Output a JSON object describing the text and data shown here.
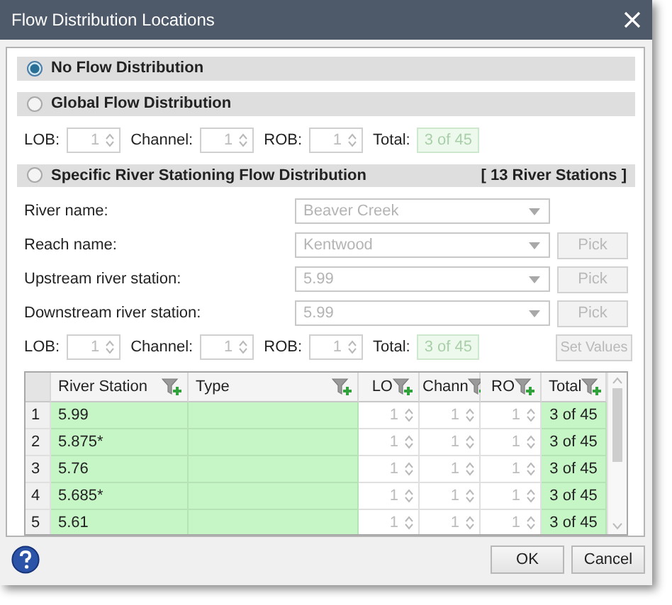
{
  "window": {
    "title": "Flow Distribution Locations"
  },
  "sections": [
    {
      "label": "No Flow Distribution",
      "selected": true
    },
    {
      "label": "Global Flow Distribution",
      "selected": false,
      "distribution": {
        "lob": {
          "label": "LOB:",
          "value": "1",
          "disabled": true
        },
        "channel": {
          "label": "Channel:",
          "value": "1",
          "disabled": true
        },
        "rob": {
          "label": "ROB:",
          "value": "1",
          "disabled": true
        },
        "total": {
          "label": "Total:",
          "value": "3 of 45"
        }
      }
    },
    {
      "label": "Specific River Stationing Flow Distribution",
      "selected": false,
      "badge": "[ 13 River Stations ]",
      "fields": [
        {
          "label": "River name:",
          "value": "Beaver Creek",
          "disabled": true
        },
        {
          "label": "Reach name:",
          "value": "Kentwood",
          "disabled": true,
          "button": {
            "label": "Pick",
            "disabled": true
          }
        },
        {
          "label": "Upstream river station:",
          "value": "5.99",
          "disabled": true,
          "button": {
            "label": "Pick",
            "disabled": true
          }
        },
        {
          "label": "Downstream river station:",
          "value": "5.99",
          "disabled": true,
          "button": {
            "label": "Pick",
            "disabled": true
          }
        }
      ],
      "distribution": {
        "lob": {
          "label": "LOB:",
          "value": "1",
          "disabled": true
        },
        "channel": {
          "label": "Channel:",
          "value": "1",
          "disabled": true
        },
        "rob": {
          "label": "ROB:",
          "value": "1",
          "disabled": true
        },
        "total": {
          "label": "Total:",
          "value": "3 of 45"
        },
        "button": {
          "label": "Set Values",
          "disabled": true
        }
      },
      "table": {
        "columns": [
          {
            "kind": "index"
          },
          {
            "kind": "text",
            "label": "River Station"
          },
          {
            "kind": "text",
            "label": "Type"
          },
          {
            "kind": "spin",
            "label": "LO"
          },
          {
            "kind": "spin",
            "label": "Chann"
          },
          {
            "kind": "spin",
            "label": "RO"
          },
          {
            "kind": "total",
            "label": "Total"
          }
        ],
        "rows": [
          {
            "index": "1",
            "station": "5.99",
            "lob": "1",
            "channel": "1",
            "rob": "1",
            "total": "3 of 45"
          },
          {
            "index": "2",
            "station": "5.875*",
            "lob": "1",
            "channel": "1",
            "rob": "1",
            "total": "3 of 45"
          },
          {
            "index": "3",
            "station": "5.76",
            "lob": "1",
            "channel": "1",
            "rob": "1",
            "total": "3 of 45"
          },
          {
            "index": "4",
            "station": "5.685*",
            "lob": "1",
            "channel": "1",
            "rob": "1",
            "total": "3 of 45"
          },
          {
            "index": "5",
            "station": "5.61",
            "lob": "1",
            "channel": "1",
            "rob": "1",
            "total": "3 of 45"
          }
        ]
      }
    }
  ],
  "buttons": [
    {
      "label": "OK"
    },
    {
      "label": "Cancel"
    }
  ]
}
